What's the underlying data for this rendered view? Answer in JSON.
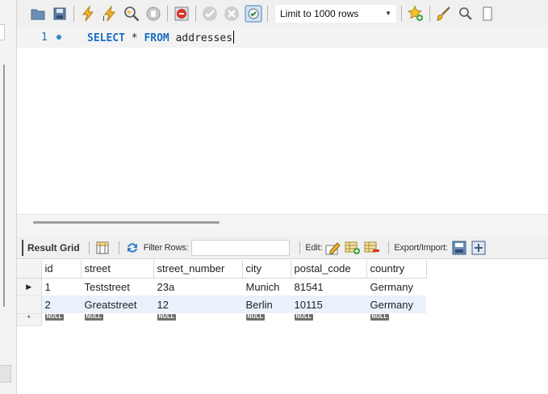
{
  "toolbar": {
    "limit_label": "Limit to 1000 rows"
  },
  "editor": {
    "line_number": "1",
    "code_kw1": "SELECT",
    "code_star": " * ",
    "code_kw2": "FROM",
    "code_ident": " addresses"
  },
  "result_bar": {
    "result_grid_label": "Result Grid",
    "filter_label": "Filter Rows:",
    "filter_value": "",
    "edit_label": "Edit:",
    "export_label": "Export/Import:"
  },
  "grid": {
    "columns": [
      "id",
      "street",
      "street_number",
      "city",
      "postal_code",
      "country"
    ],
    "rows": [
      [
        "1",
        "Teststreet",
        "23a",
        "Munich",
        "81541",
        "Germany"
      ],
      [
        "2",
        "Greatstreet",
        "12",
        "Berlin",
        "10115",
        "Germany"
      ]
    ],
    "null_label": "NULL",
    "current_row_marker": "▶",
    "new_row_marker": "*"
  },
  "colors": {
    "keyword": "#1a6ec4",
    "row_alt": "#e9f1fb",
    "null_badge": "#6f6f6f"
  }
}
